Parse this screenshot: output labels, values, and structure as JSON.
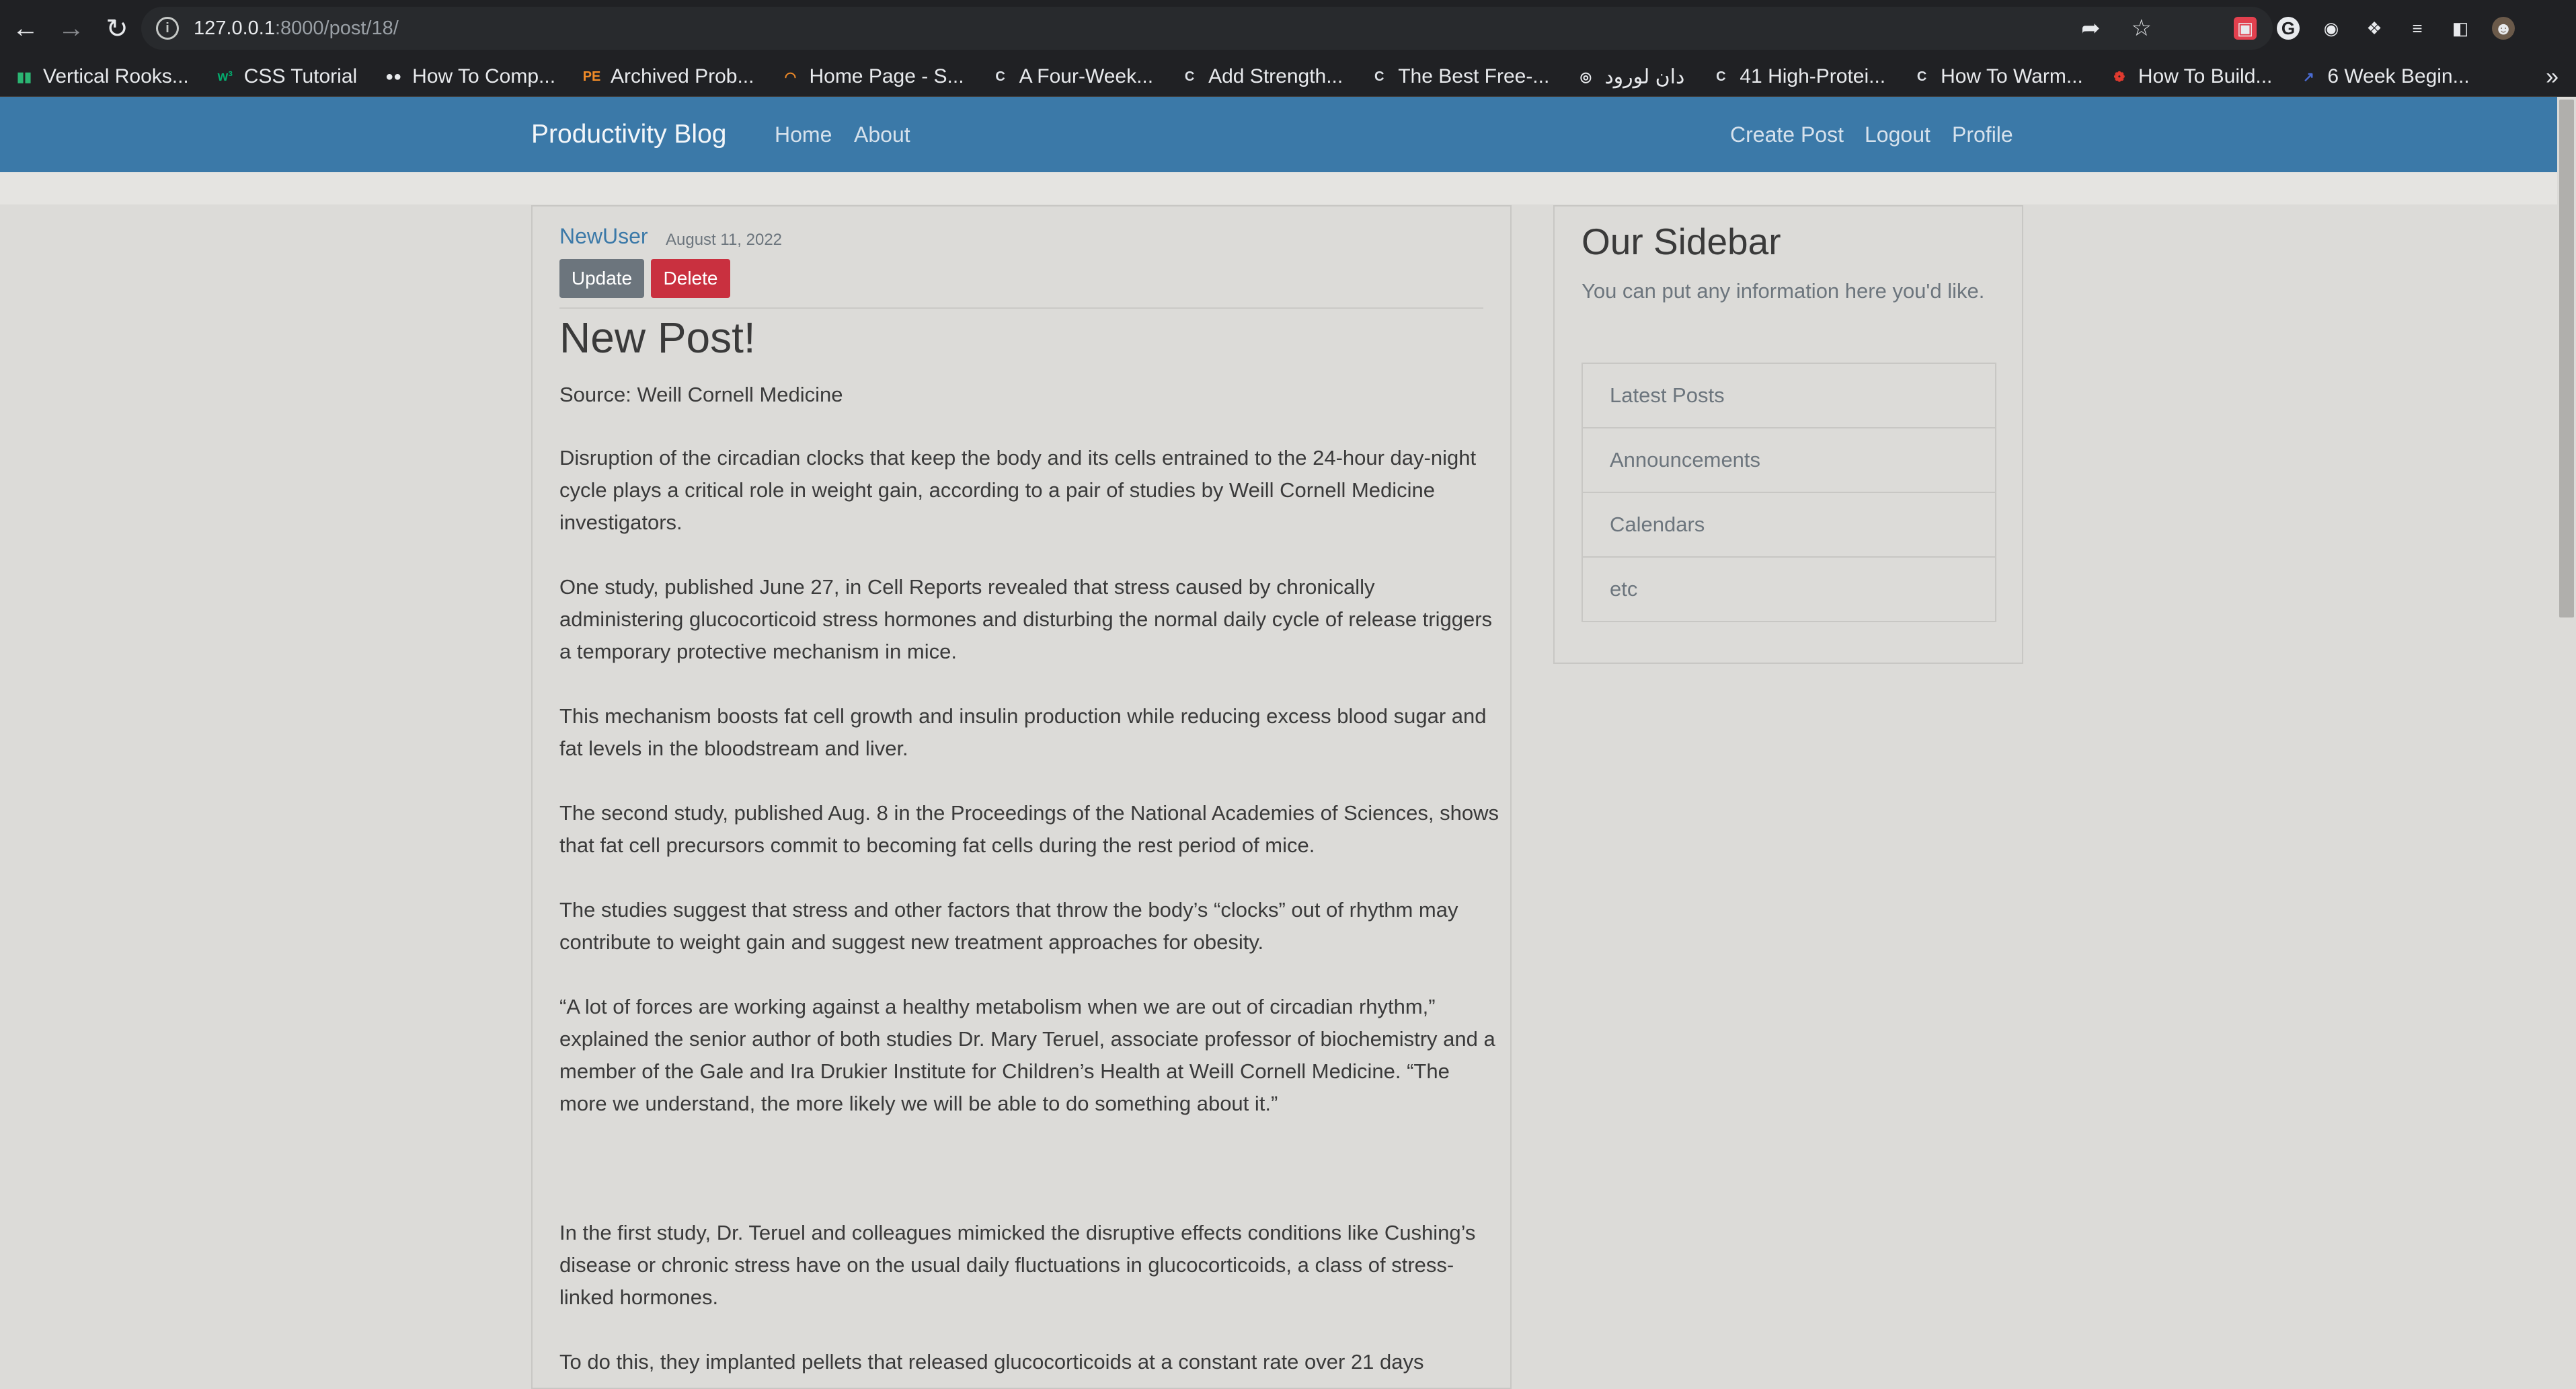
{
  "browser": {
    "url_host": "127.0.0.1",
    "url_rest": ":8000/post/18/",
    "bookmarks": [
      {
        "label": "Vertical Rooks...",
        "icon": "rooks-favicon-icon",
        "color": "#2bb673",
        "glyph": "▮▮"
      },
      {
        "label": "CSS Tutorial",
        "icon": "w3schools-favicon-icon",
        "color": "#04aa6d",
        "glyph": "w³"
      },
      {
        "label": "How To Comp...",
        "icon": "medium-favicon-icon",
        "color": "#e8eaed",
        "glyph": "●●"
      },
      {
        "label": "Archived Prob...",
        "icon": "pe-favicon-icon",
        "color": "#f28c28",
        "glyph": "PE"
      },
      {
        "label": "Home Page - S...",
        "icon": "arc-favicon-icon",
        "color": "#f28c28",
        "glyph": "◠"
      },
      {
        "label": "A Four-Week...",
        "icon": "c-favicon-icon",
        "color": "#dfe3e8",
        "glyph": "C"
      },
      {
        "label": "Add Strength...",
        "icon": "c-favicon-icon",
        "color": "#dfe3e8",
        "glyph": "C"
      },
      {
        "label": "The Best Free-...",
        "icon": "c-favicon-icon",
        "color": "#dfe3e8",
        "glyph": "C"
      },
      {
        "label": "دان لورود",
        "icon": "globe-icon",
        "color": "#e8eaed",
        "glyph": "◎"
      },
      {
        "label": "41 High-Protei...",
        "icon": "c-favicon-icon",
        "color": "#dfe3e8",
        "glyph": "C"
      },
      {
        "label": "How To Warm...",
        "icon": "c-favicon-icon",
        "color": "#dfe3e8",
        "glyph": "C"
      },
      {
        "label": "How To Build...",
        "icon": "bodybuilding-favicon-icon",
        "color": "#e03a2f",
        "glyph": "❁"
      },
      {
        "label": "6 Week Begin...",
        "icon": "runner-favicon-icon",
        "color": "#4a6cd4",
        "glyph": "↗"
      }
    ],
    "bookmarks_more": "»"
  },
  "site": {
    "brand": "Productivity Blog",
    "nav_left": [
      "Home",
      "About"
    ],
    "nav_right": [
      "Create Post",
      "Logout",
      "Profile"
    ]
  },
  "post": {
    "author": "NewUser",
    "date": "August 11, 2022",
    "update_label": "Update",
    "delete_label": "Delete",
    "title": "New Post!",
    "paragraphs": [
      "Source: Weill Cornell Medicine",
      "Disruption of the circadian clocks that keep the body and its cells entrained to the 24-hour day-night cycle plays a critical role in weight gain, according to a pair of studies by Weill Cornell Medicine investigators.",
      "One study, published June 27, in Cell Reports revealed that stress caused by chronically administering glucocorticoid stress hormones and disturbing the normal daily cycle of release triggers a temporary protective mechanism in mice.",
      "This mechanism boosts fat cell growth and insulin production while reducing excess blood sugar and fat levels in the bloodstream and liver.",
      "The second study, published Aug. 8 in the Proceedings of the National Academies of Sciences, shows that fat cell precursors commit to becoming fat cells during the rest period of mice.",
      "The studies suggest that stress and other factors that throw the body’s “clocks” out of rhythm may contribute to weight gain and suggest new treatment approaches for obesity.",
      "“A lot of forces are working against a healthy metabolism when we are out of circadian rhythm,” explained the senior author of both studies Dr. Mary Teruel, associate professor of biochemistry and a member of the Gale and Ira Drukier Institute for Children’s Health at Weill Cornell Medicine. “The more we understand, the more likely we will be able to do something about it.”",
      "In the first study, Dr. Teruel and colleagues mimicked the disruptive effects conditions like Cushing’s disease or chronic stress have on the usual daily fluctuations in glucocorticoids, a class of stress-linked hormones.",
      "To do this, they implanted pellets that released glucocorticoids at a constant rate over 21 days"
    ]
  },
  "sidebar": {
    "title": "Our Sidebar",
    "text": "You can put any information here you'd like.",
    "items": [
      "Latest Posts",
      "Announcements",
      "Calendars",
      "etc"
    ]
  }
}
